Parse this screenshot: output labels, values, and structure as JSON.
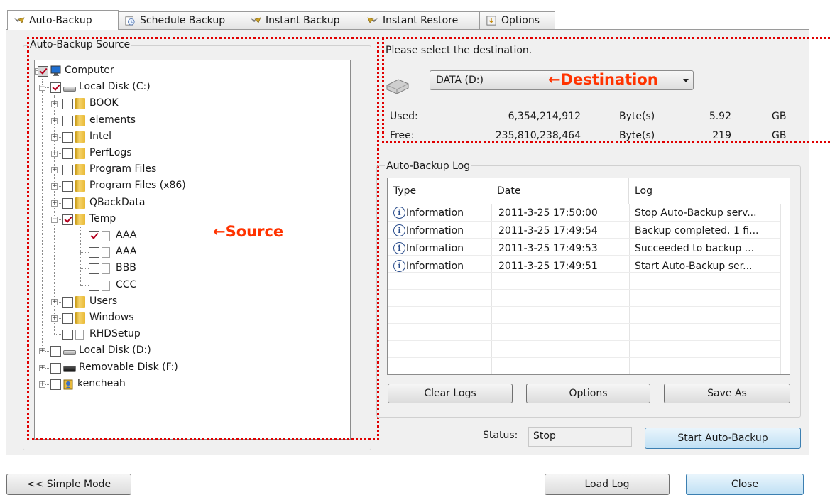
{
  "tabs": [
    {
      "label": "Auto-Backup",
      "icon": "backup-wand-icon"
    },
    {
      "label": "Schedule Backup",
      "icon": "clock-icon"
    },
    {
      "label": "Instant Backup",
      "icon": "backup-wand-icon"
    },
    {
      "label": "Instant Restore",
      "icon": "restore-wand-icon"
    },
    {
      "label": "Options",
      "icon": "options-icon"
    }
  ],
  "source": {
    "group_label": "Auto-Backup Source",
    "tree": [
      {
        "label": "Computer",
        "checked": true
      },
      {
        "label": "Local Disk (C:)",
        "checked": true
      },
      {
        "label": "BOOK",
        "checked": false
      },
      {
        "label": "elements",
        "checked": false
      },
      {
        "label": "Intel",
        "checked": false
      },
      {
        "label": "PerfLogs",
        "checked": false
      },
      {
        "label": "Program Files",
        "checked": false
      },
      {
        "label": "Program Files (x86)",
        "checked": false
      },
      {
        "label": "QBackData",
        "checked": false
      },
      {
        "label": "Temp",
        "checked": true
      },
      {
        "label": "AAA",
        "checked": true
      },
      {
        "label": "AAA",
        "checked": false
      },
      {
        "label": "BBB",
        "checked": false
      },
      {
        "label": "CCC",
        "checked": false
      },
      {
        "label": "Users",
        "checked": false
      },
      {
        "label": "Windows",
        "checked": false
      },
      {
        "label": "RHDSetup",
        "checked": false
      },
      {
        "label": "Local Disk (D:)",
        "checked": false
      },
      {
        "label": "Removable Disk (F:)",
        "checked": false
      },
      {
        "label": "kencheah",
        "checked": false
      }
    ]
  },
  "annotations": {
    "source": "←Source",
    "destination": "←Destination"
  },
  "destination": {
    "prompt": "Please select the destination.",
    "selected": "DATA (D:)",
    "used": {
      "label": "Used:",
      "bytes": "6,354,214,912",
      "unit": "Byte(s)",
      "size": "5.92",
      "size_unit": "GB"
    },
    "free": {
      "label": "Free:",
      "bytes": "235,810,238,464",
      "unit": "Byte(s)",
      "size": "219",
      "size_unit": "GB"
    }
  },
  "log": {
    "group_label": "Auto-Backup Log",
    "columns": [
      "Type",
      "Date",
      "Log"
    ],
    "rows": [
      {
        "type": "Information",
        "date": "2011-3-25 17:50:00",
        "log": "Stop Auto-Backup serv..."
      },
      {
        "type": "Information",
        "date": "2011-3-25 17:49:54",
        "log": "Backup completed. 1 fi..."
      },
      {
        "type": "Information",
        "date": "2011-3-25 17:49:53",
        "log": "Succeeded to backup ..."
      },
      {
        "type": "Information",
        "date": "2011-3-25 17:49:51",
        "log": "Start Auto-Backup ser..."
      }
    ],
    "buttons": {
      "clear": "Clear Logs",
      "options": "Options",
      "save_as": "Save As"
    }
  },
  "status": {
    "label": "Status:",
    "value": "Stop",
    "start_button": "Start Auto-Backup"
  },
  "footer": {
    "simple_mode": "<< Simple Mode",
    "load_log": "Load Log",
    "close": "Close"
  },
  "colors": {
    "annotation": "#ff3300",
    "dotted_border": "#e00000",
    "accent_button": "#3c7fb1"
  }
}
